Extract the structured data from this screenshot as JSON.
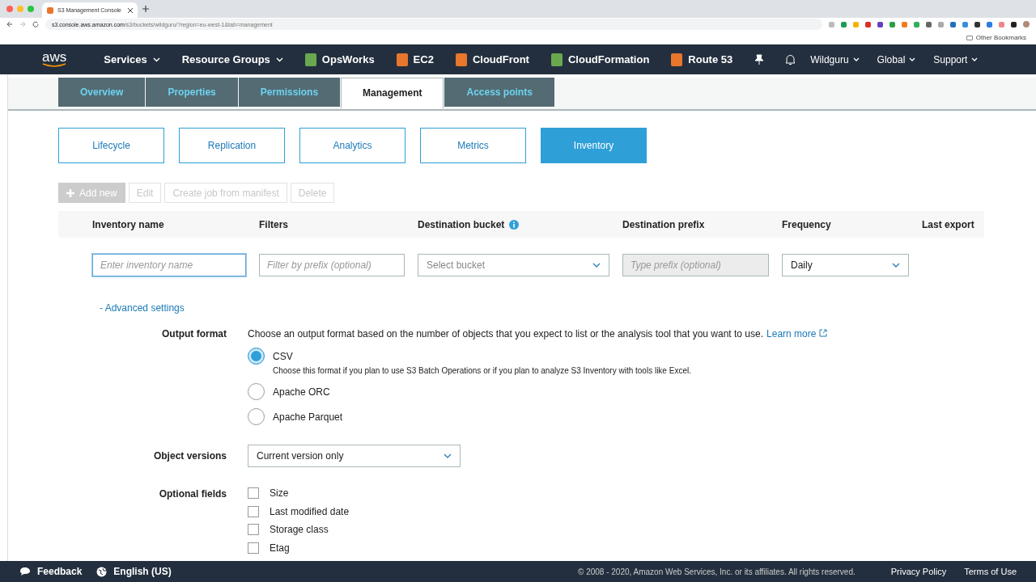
{
  "browser": {
    "tab_title": "S3 Management Console",
    "url_host": "s3.console.aws.amazon.com",
    "url_path": "/s3/buckets/wildguru/?region=eu-west-1&tab=management",
    "bookmarks": "Other Bookmarks"
  },
  "nav": {
    "logo": "aws",
    "items": [
      {
        "kind": "menu",
        "label": "Services"
      },
      {
        "kind": "menu",
        "label": "Resource Groups"
      },
      {
        "kind": "service",
        "label": "OpsWorks",
        "color": "#6aa84f"
      },
      {
        "kind": "service",
        "label": "EC2",
        "color": "#e8762c"
      },
      {
        "kind": "service",
        "label": "CloudFront",
        "color": "#e8762c"
      },
      {
        "kind": "service",
        "label": "CloudFormation",
        "color": "#6aa84f"
      },
      {
        "kind": "service",
        "label": "Route 53",
        "color": "#e8762c"
      }
    ],
    "account": [
      {
        "label": "Wildguru"
      },
      {
        "label": "Global"
      },
      {
        "label": "Support"
      }
    ]
  },
  "tabs": [
    {
      "label": "Overview",
      "selected": false
    },
    {
      "label": "Properties",
      "selected": false
    },
    {
      "label": "Permissions",
      "selected": false
    },
    {
      "label": "Management",
      "selected": true
    },
    {
      "label": "Access points",
      "selected": false
    }
  ],
  "subtabs": [
    {
      "label": "Lifecycle",
      "selected": false
    },
    {
      "label": "Replication",
      "selected": false
    },
    {
      "label": "Analytics",
      "selected": false
    },
    {
      "label": "Metrics",
      "selected": false
    },
    {
      "label": "Inventory",
      "selected": true
    }
  ],
  "actions": [
    {
      "kind": "add",
      "label": "Add new",
      "disabled": true
    },
    {
      "kind": "plain",
      "label": "Edit",
      "disabled": true
    },
    {
      "kind": "plain",
      "label": "Create job from manifest",
      "disabled": true
    },
    {
      "kind": "plain",
      "label": "Delete",
      "disabled": true
    }
  ],
  "table": {
    "columns": [
      {
        "label": "Inventory name",
        "info": false
      },
      {
        "label": "Filters",
        "info": false
      },
      {
        "label": "Destination bucket",
        "info": true
      },
      {
        "label": "Destination prefix",
        "info": false
      },
      {
        "label": "Frequency",
        "info": false
      },
      {
        "label": "Last export",
        "info": false
      }
    ],
    "fields": [
      {
        "kind": "text",
        "placeholder": "Enter inventory name",
        "focused": true,
        "disabled": false
      },
      {
        "kind": "text",
        "placeholder": "Filter by prefix (optional)",
        "focused": false,
        "disabled": false
      },
      {
        "kind": "select",
        "placeholder": "Select bucket"
      },
      {
        "kind": "text",
        "placeholder": "Type prefix (optional)",
        "focused": false,
        "disabled": true
      },
      {
        "kind": "select",
        "value": "Daily"
      }
    ]
  },
  "advanced": {
    "label": "- Advanced settings"
  },
  "output_format": {
    "label": "Output format",
    "description": "Choose an output format based on the number of objects that you expect to list or the analysis tool that you want to use.",
    "link": "Learn more",
    "options": [
      {
        "label": "CSV",
        "description": "Choose this format if you plan to use S3 Batch Operations or if you plan to analyze S3 Inventory with tools like Excel.",
        "selected": true
      },
      {
        "label": "Apache ORC",
        "selected": false
      },
      {
        "label": "Apache Parquet",
        "selected": false
      }
    ]
  },
  "object_versions": {
    "label": "Object versions",
    "value": "Current version only"
  },
  "optional_fields": {
    "label": "Optional fields",
    "options": [
      {
        "label": "Size",
        "checked": false
      },
      {
        "label": "Last modified date",
        "checked": false
      },
      {
        "label": "Storage class",
        "checked": false
      },
      {
        "label": "Etag",
        "checked": false
      }
    ]
  },
  "footer": {
    "feedback": "Feedback",
    "language": "English (US)",
    "copyright": "© 2008 - 2020, Amazon Web Services, Inc. or its affiliates. All rights reserved.",
    "links": [
      "Privacy Policy",
      "Terms of Use"
    ]
  }
}
